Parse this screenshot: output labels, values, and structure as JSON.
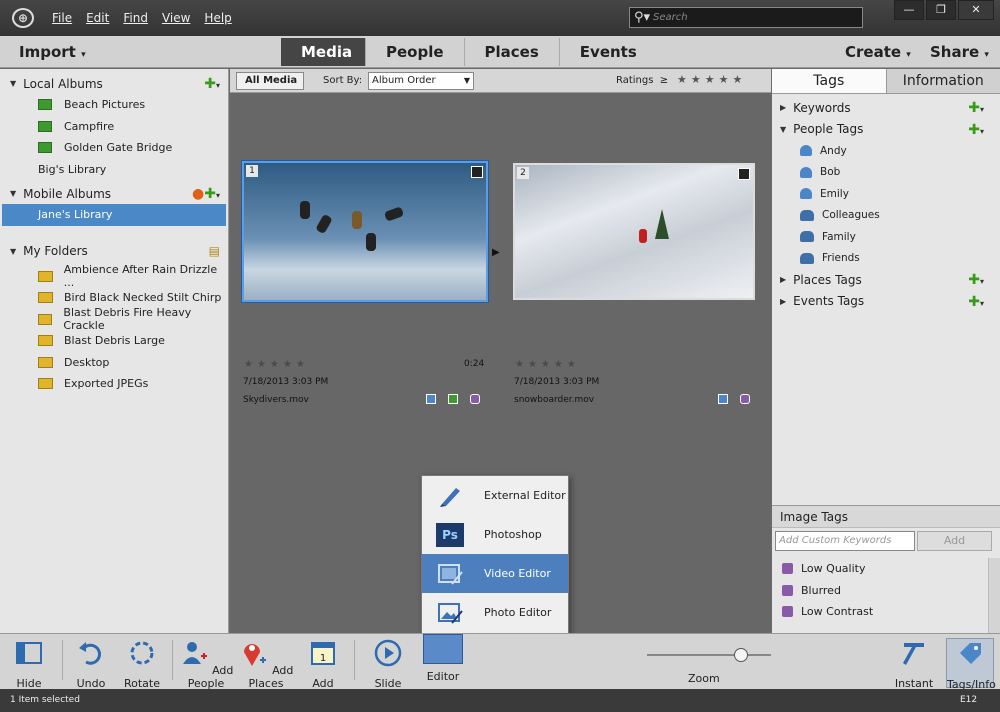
{
  "menu": {
    "file": "File",
    "edit": "Edit",
    "find": "Find",
    "view": "View",
    "help": "Help"
  },
  "search": {
    "placeholder": "Search"
  },
  "modebar": {
    "import": "Import",
    "tabs": [
      "Media",
      "People",
      "Places",
      "Events"
    ],
    "create": "Create",
    "share": "Share"
  },
  "left": {
    "local_albums": "Local Albums",
    "albums": [
      "Beach Pictures",
      "Campfire",
      "Golden Gate Bridge"
    ],
    "library": "Big's Library",
    "mobile_albums": "Mobile Albums",
    "mobile_selected": "Jane's Library",
    "my_folders": "My Folders",
    "folders": [
      "Ambience After Rain Drizzle ...",
      "Bird Black Necked Stilt Chirp",
      "Blast Debris Fire Heavy Crackle",
      "Blast Debris Large",
      "Desktop",
      "Exported JPEGs"
    ]
  },
  "grid": {
    "all_media": "All Media",
    "sort_by": "Sort By:",
    "sort_value": "Album Order",
    "ratings": "Ratings",
    "items": [
      {
        "index": "1",
        "date": "7/18/2013 3:03 PM",
        "filename": "Skydivers.mov",
        "duration": "0:24"
      },
      {
        "index": "2",
        "date": "7/18/2013 3:03 PM",
        "filename": "snowboarder.mov"
      }
    ]
  },
  "right": {
    "tabs": [
      "Tags",
      "Information"
    ],
    "keywords": "Keywords",
    "people_tags": "People Tags",
    "people": [
      "Andy",
      "Bob",
      "Emily"
    ],
    "groups": [
      "Colleagues",
      "Family",
      "Friends"
    ],
    "places_tags": "Places Tags",
    "events_tags": "Events Tags",
    "image_tags": "Image Tags",
    "kw_placeholder": "Add Custom Keywords",
    "add": "Add",
    "image_tag_items": [
      "Low Quality",
      "Blurred",
      "Low Contrast"
    ]
  },
  "popup": {
    "items": [
      "External Editor",
      "Photoshop",
      "Video Editor",
      "Photo Editor"
    ]
  },
  "toolbar": {
    "hide_panel": "Hide Panel",
    "undo": "Undo",
    "rotate": "Rotate",
    "add_people": "Add People",
    "add_places": "Add Places",
    "add_event": "Add Event",
    "slide_show": "Slide Show",
    "editor": "Editor",
    "zoom": "Zoom",
    "instant_fix": "Instant Fix",
    "tags_info": "Tags/Info"
  },
  "status": {
    "text": "1 Item selected",
    "code": "E12"
  },
  "icons": {
    "logo": "elements-logo-icon",
    "search": "search-icon"
  }
}
